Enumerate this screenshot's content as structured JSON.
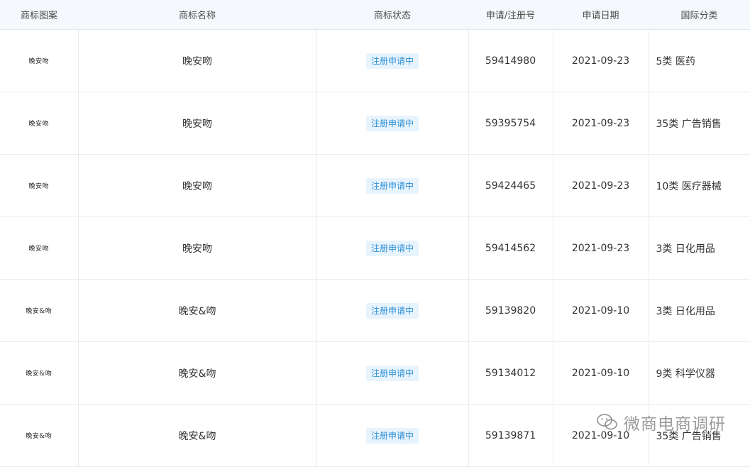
{
  "headers": {
    "logo": "商标图案",
    "name": "商标名称",
    "status": "商标状态",
    "reg_no": "申请/注册号",
    "date": "申请日期",
    "class": "国际分类"
  },
  "rows": [
    {
      "logo": "晚安吻",
      "name": "晚安吻",
      "status": "注册申请中",
      "reg_no": "59414980",
      "date": "2021-09-23",
      "class": "5类 医药"
    },
    {
      "logo": "晚安吻",
      "name": "晚安吻",
      "status": "注册申请中",
      "reg_no": "59395754",
      "date": "2021-09-23",
      "class": "35类 广告销售"
    },
    {
      "logo": "晚安吻",
      "name": "晚安吻",
      "status": "注册申请中",
      "reg_no": "59424465",
      "date": "2021-09-23",
      "class": "10类 医疗器械"
    },
    {
      "logo": "晚安吻",
      "name": "晚安吻",
      "status": "注册申请中",
      "reg_no": "59414562",
      "date": "2021-09-23",
      "class": "3类 日化用品"
    },
    {
      "logo": "晚安&吻",
      "name": "晚安&吻",
      "status": "注册申请中",
      "reg_no": "59139820",
      "date": "2021-09-10",
      "class": "3类 日化用品"
    },
    {
      "logo": "晚安&吻",
      "name": "晚安&吻",
      "status": "注册申请中",
      "reg_no": "59134012",
      "date": "2021-09-10",
      "class": "9类 科学仪器"
    },
    {
      "logo": "晚安&吻",
      "name": "晚安&吻",
      "status": "注册申请中",
      "reg_no": "59139871",
      "date": "2021-09-10",
      "class": "35类 广告销售"
    }
  ],
  "watermark": "微商电商调研",
  "colors": {
    "badge_bg": "#e8f4fd",
    "badge_text": "#2c8fd6",
    "header_bg": "#f5f8fc"
  }
}
